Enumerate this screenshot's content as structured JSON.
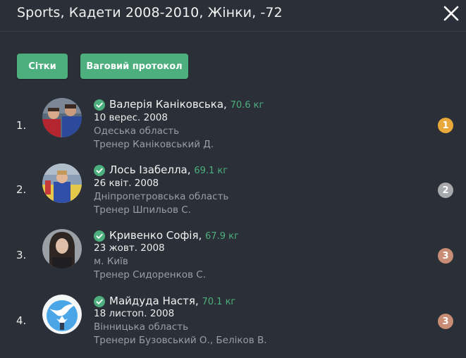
{
  "header": {
    "title": "Sports, Кадети 2008-2010, Жінки, -72",
    "close_icon": "close-icon"
  },
  "toolbar": {
    "grids_label": "Сітки",
    "weigh_protocol_label": "Ваговий протокол"
  },
  "colors": {
    "accent": "#4caf7d",
    "background": "#2b3038",
    "gold": "#e8a93a",
    "silver": "#a7a9ac",
    "bronze": "#c98c75"
  },
  "athletes": [
    {
      "place": "1.",
      "name": "Валерія Каніковська,",
      "weight": "70.6 кг",
      "dob": "10 верес. 2008",
      "region": "Одеська область",
      "coach": "Тренер Каніковський Д.",
      "medal": "1",
      "medal_color": "#e8a93a",
      "avatar_icon": "athlete-photo"
    },
    {
      "place": "2.",
      "name": "Лось Ізабелла,",
      "weight": "69.1 кг",
      "dob": "26 квіт. 2008",
      "region": "Дніпропетровська область",
      "coach": "Тренер Шпильов С.",
      "medal": "2",
      "medal_color": "#a7a9ac",
      "avatar_icon": "athlete-photo"
    },
    {
      "place": "3.",
      "name": "Кривенко Софія,",
      "weight": "67.9 кг",
      "dob": "23 жовт. 2008",
      "region": "м. Київ",
      "coach": "Тренер Сидоренков С.",
      "medal": "3",
      "medal_color": "#c98c75",
      "avatar_icon": "athlete-photo"
    },
    {
      "place": "4.",
      "name": "Майдуда Настя,",
      "weight": "70.1 кг",
      "dob": "18 листоп. 2008",
      "region": "Вінницька область",
      "coach": "Тренери Бузовський О.,  Беліков В.",
      "medal": "3",
      "medal_color": "#c98c75",
      "avatar_icon": "club-logo"
    }
  ]
}
